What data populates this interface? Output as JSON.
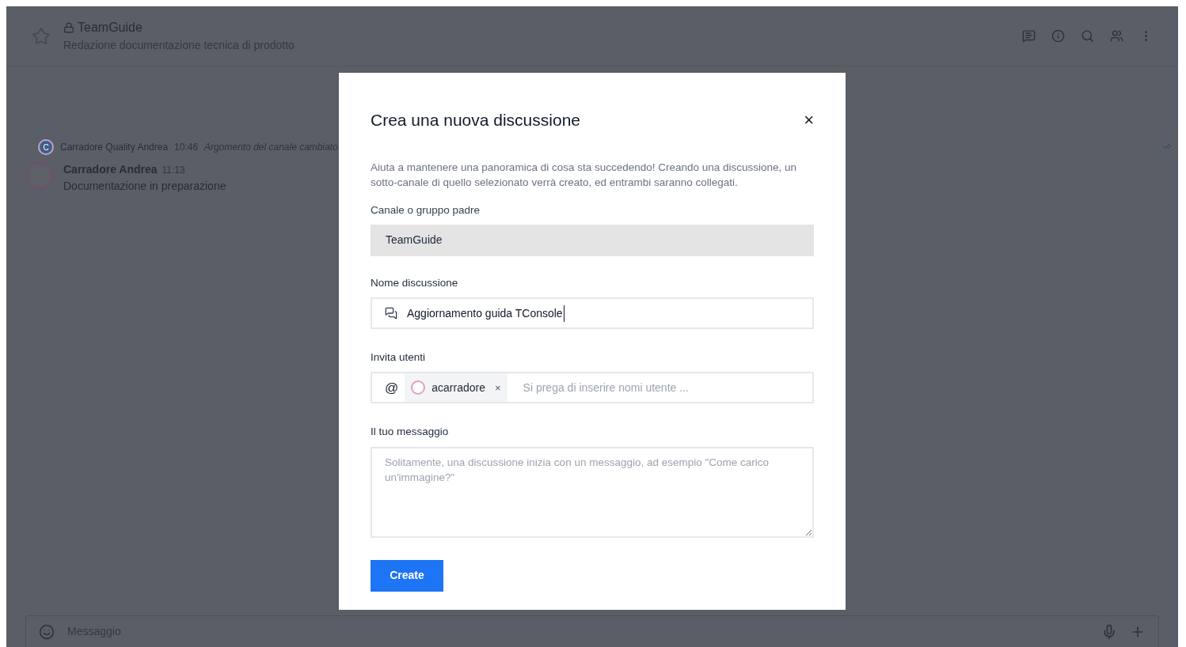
{
  "channel": {
    "name": "TeamGuide",
    "topic": "Redazione documentazione tecnica di prodotto"
  },
  "messages": [
    {
      "kind": "system",
      "author": "Carradore Quality Andrea",
      "time": "10:46",
      "text": "Argomento del canale cambiato",
      "avatar": "C"
    },
    {
      "kind": "user",
      "author": "Carradore Andrea",
      "time": "11:13",
      "text": "Documentazione in preparazione"
    }
  ],
  "composer": {
    "placeholder": "Messaggio"
  },
  "modal": {
    "title": "Crea una nuova discussione",
    "close": "×",
    "description": "Aiuta a mantenere una panoramica di cosa sta succedendo! Creando una discussione, un sotto-canale di quello selezionato verrà creato, ed entrambi saranno collegati.",
    "parent": {
      "label": "Canale o gruppo padre",
      "value": "TeamGuide",
      "disabled": true
    },
    "name": {
      "label": "Nome discussione",
      "value": "Aggiornamento guida TConsole"
    },
    "invite": {
      "label": "Invita utenti",
      "at": "@",
      "users": [
        {
          "name": "acarradore",
          "remove": "×"
        }
      ],
      "placeholder": "Si prega di inserire nomi utente ..."
    },
    "message": {
      "label": "Il tuo messaggio",
      "placeholder": "Solitamente, una discussione inizia con un messaggio, ad esempio \"Come carico un'immagine?\""
    },
    "submit": "Create"
  }
}
